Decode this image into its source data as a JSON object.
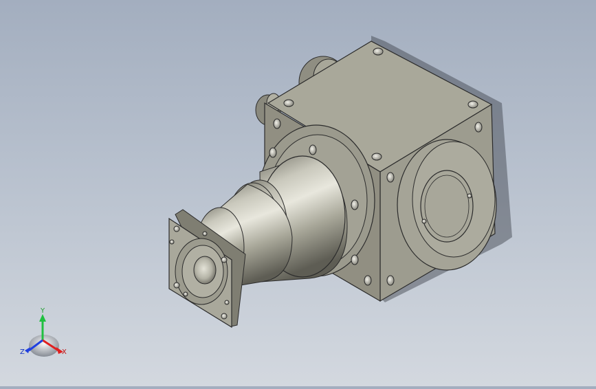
{
  "viewport": {
    "background_top": "#a3aebf",
    "background_bottom": "#d3d8df",
    "model_color": "#a6a595",
    "edge_color": "#2b2b2b"
  },
  "model": {
    "icon": "right-angle-gearbox-3d-model"
  },
  "triad": {
    "icon": "xyz-axis-triad-icon",
    "labels": {
      "x": "X",
      "y": "Y",
      "z": "Z"
    },
    "colors": {
      "x": "#e02020",
      "y": "#20c040",
      "z": "#2040e0"
    }
  }
}
